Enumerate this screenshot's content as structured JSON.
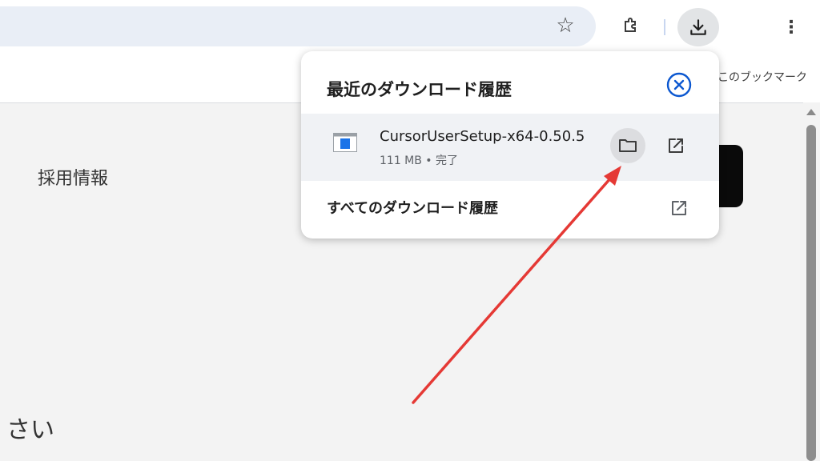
{
  "toolbar": {
    "icons": [
      "star-icon",
      "extensions-icon",
      "download-icon",
      "more-vert-icon"
    ],
    "star_glyph": "☆",
    "kebab_glyph": "⋮"
  },
  "bookmarks_bar": {
    "label": "このブックマーク"
  },
  "page": {
    "recruit": "採用情報",
    "bottom_text": "さい"
  },
  "downloads_popup": {
    "title": "最近のダウンロード履歴",
    "item": {
      "file_name": "CursorUserSetup-x64-0.50.5",
      "status": "111 MB • 完了"
    },
    "all_history_label": "すべてのダウンロード履歴"
  },
  "annotation": {
    "color": "#e53935"
  },
  "colors": {
    "accent": "#0b57d0",
    "omnibox": "#e9eef6"
  }
}
